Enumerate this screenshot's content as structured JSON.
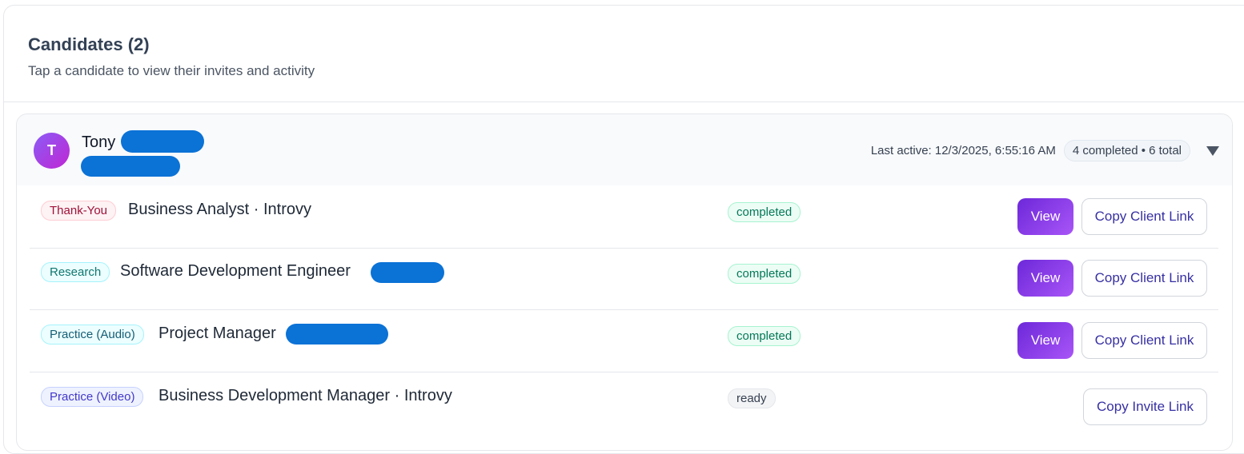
{
  "section": {
    "title": "Candidates (2)",
    "subtitle": "Tap a candidate to view their invites and activity"
  },
  "candidate": {
    "avatar_initial": "T",
    "name": "Tony",
    "last_active": "Last active: 12/3/2025, 6:55:16 AM",
    "summary": "4 completed • 6 total",
    "rows": [
      {
        "tag": "Thank-You",
        "role": "Business Analyst · Introvy",
        "status": "completed",
        "view_label": "View",
        "copy_label": "Copy Client Link"
      },
      {
        "tag": "Research",
        "role": "Software Development Engineer",
        "status": "completed",
        "view_label": "View",
        "copy_label": "Copy Client Link"
      },
      {
        "tag": "Practice (Audio)",
        "role": "Project Manager",
        "status": "completed",
        "view_label": "View",
        "copy_label": "Copy Client Link"
      },
      {
        "tag": "Practice (Video)",
        "role": "Business Development Manager · Introvy",
        "status": "ready",
        "copy_label": "Copy Invite Link"
      }
    ]
  },
  "colors": {
    "accent": "#7c3aed",
    "redaction": "#0b72d6"
  },
  "icons": {
    "expand": "caret-down-icon"
  }
}
